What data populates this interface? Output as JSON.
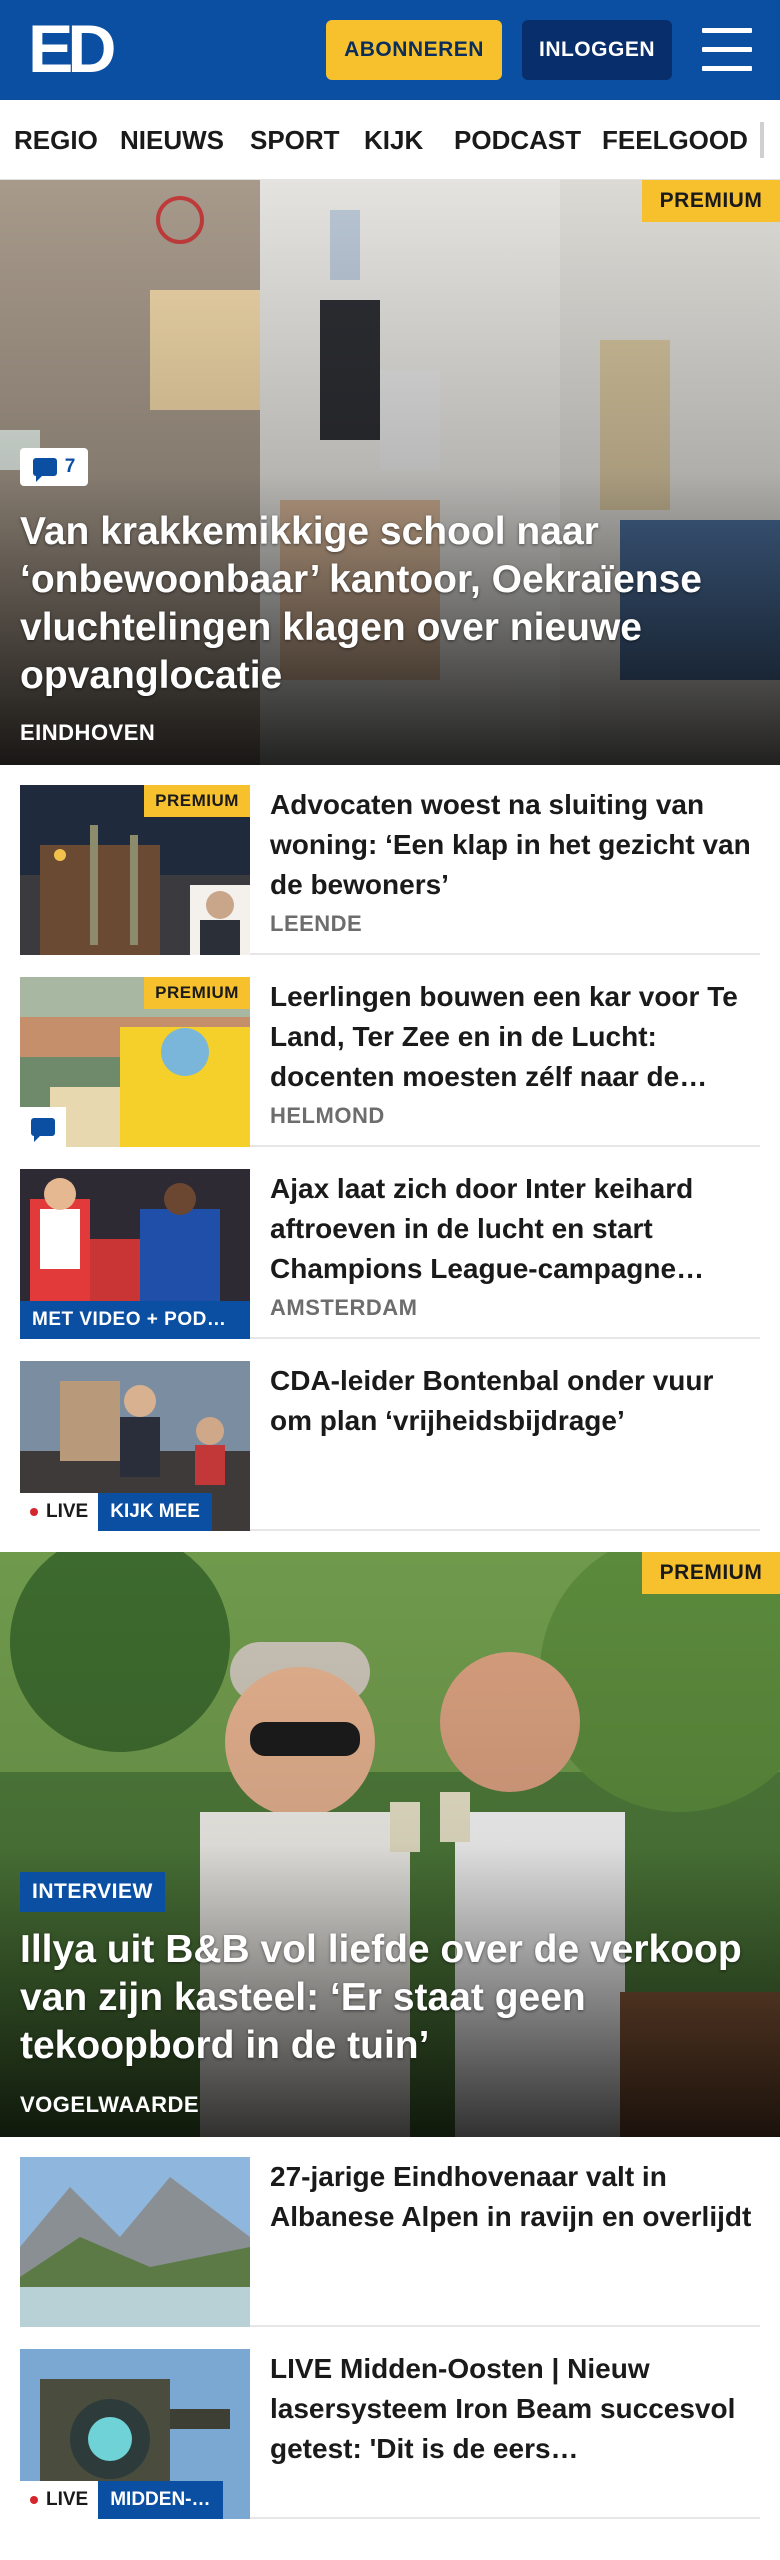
{
  "header": {
    "logo_text": "ED",
    "subscribe_label": "ABONNEREN",
    "login_label": "INLOGGEN",
    "menu_icon": "hamburger-menu-icon"
  },
  "nav": {
    "items": [
      "REGIO",
      "NIEUWS",
      "SPORT",
      "KIJK",
      "PODCAST",
      "FEELGOOD"
    ]
  },
  "hero1": {
    "premium": "PREMIUM",
    "comments": "7",
    "title": "Van krakkemikkige school naar ‘onbewoonbaar’ kantoor, Oekraïense vluchtelingen klagen over nieuwe opvanglocatie",
    "location": "EINDHOVEN"
  },
  "articles": [
    {
      "title": "Advocaten woest na sluiting van woning: ‘Een klap in het gezicht van de bewoners’",
      "location": "LEENDE",
      "premium": "PREMIUM"
    },
    {
      "title": "Leerlingen bouwen een kar voor Te Land, Ter Zee en in de Lucht: docenten moesten zélf naar de…",
      "location": "HELMOND",
      "premium": "PREMIUM"
    },
    {
      "title": "Ajax laat zich door Inter keihard aftroeven in de lucht en start Champions League-campagne…",
      "location": "AMSTERDAM",
      "tag": "MET VIDEO + POD…"
    },
    {
      "title": "CDA-leider Bontenbal onder vuur om plan ‘vrijheidsbijdrage’",
      "live": "LIVE",
      "tag": "KIJK MEE"
    }
  ],
  "hero2": {
    "premium": "PREMIUM",
    "tag": "INTERVIEW",
    "title": "Illya uit B&B vol liefde over de verkoop van zijn kasteel: ‘Er staat geen tekoopbord in de tuin’",
    "location": "VOGELWAARDE"
  },
  "articles2": [
    {
      "title": "27-jarige Eindhovenaar valt in Albanese Alpen in ravijn en overlijdt"
    },
    {
      "title": "LIVE Midden-Oosten | Nieuw lasersysteem Iron Beam succesvol getest: 'Dit is de eers…",
      "live": "LIVE",
      "tag": "MIDDEN-…"
    }
  ],
  "colors": {
    "brand_blue": "#0b4fa3",
    "premium_yellow": "#f7c12d",
    "live_red": "#d4262c"
  }
}
